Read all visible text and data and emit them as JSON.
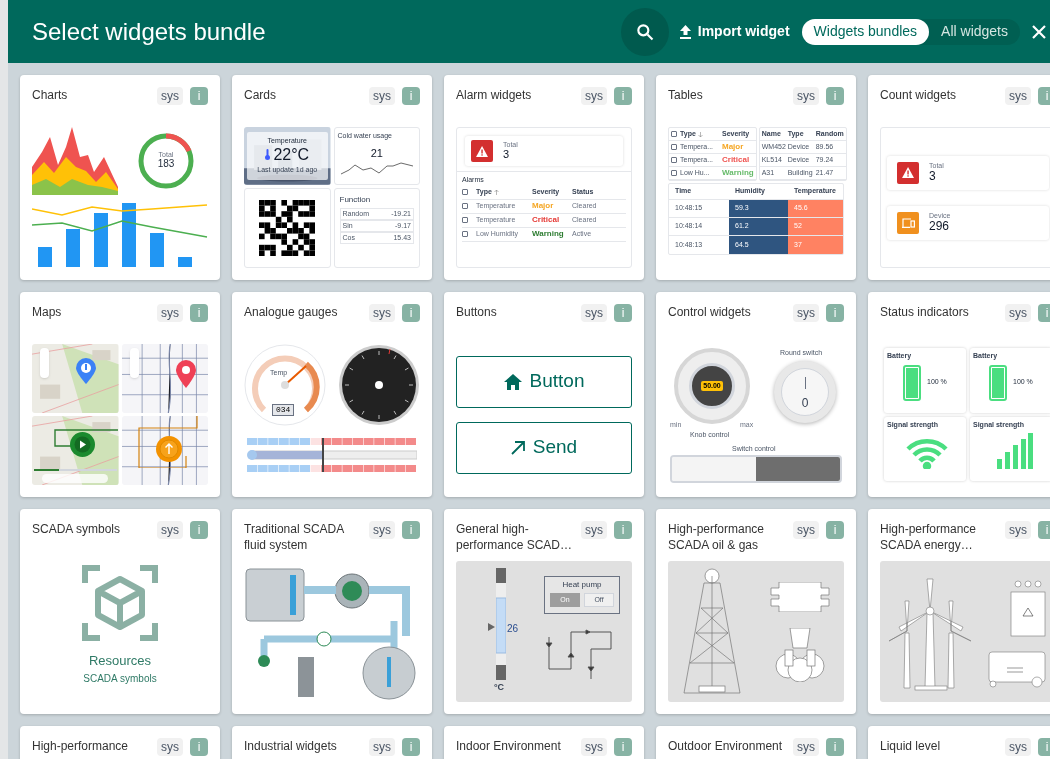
{
  "header": {
    "title": "Select widgets bundle",
    "import_label": "Import widget",
    "view_toggle": [
      {
        "label": "Widgets bundles",
        "selected": true
      },
      {
        "label": "All widgets",
        "selected": false
      }
    ]
  },
  "bundles": [
    {
      "title": "Charts",
      "badge": "sys",
      "info": "i",
      "preview": {
        "kind": "charts",
        "total_label": "Total",
        "total_value": "183"
      }
    },
    {
      "title": "Cards",
      "badge": "sys",
      "info": "i",
      "preview": {
        "kind": "cards",
        "temperature_label": "Temperature",
        "temperature_value": "22°C",
        "updated": "Last update 1d ago",
        "water_title": "Cold water usage",
        "water_value": "21",
        "function_title": "Function",
        "function_rows": [
          {
            "name": "Random",
            "value": "-19.21"
          },
          {
            "name": "Sin",
            "value": "-9.17"
          },
          {
            "name": "Cos",
            "value": "15.43"
          }
        ]
      }
    },
    {
      "title": "Alarm widgets",
      "badge": "sys",
      "info": "i",
      "preview": {
        "kind": "alarms",
        "total_label": "Total",
        "total_value": "3",
        "table_title": "Alarms",
        "all_checked": false,
        "columns": [
          "Type",
          "Severity",
          "Status"
        ],
        "rows": [
          {
            "checked": false,
            "type": "Temperature",
            "severity": "Major",
            "color": "#f5a623",
            "status": "Cleared"
          },
          {
            "checked": false,
            "type": "Temperature",
            "severity": "Critical",
            "color": "#e53935",
            "status": "Cleared"
          },
          {
            "checked": false,
            "type": "Low Humidity",
            "severity": "Warning",
            "color": "#2e7d32",
            "status": "Active"
          }
        ]
      }
    },
    {
      "title": "Tables",
      "badge": "sys",
      "info": "i",
      "preview": {
        "kind": "tables",
        "all_checked": false,
        "alarm_columns": [
          "Type",
          "Severity"
        ],
        "alarm_rows": [
          {
            "checked": false,
            "type": "Tempera...",
            "severity": "Major",
            "color": "#f5a623"
          },
          {
            "checked": false,
            "type": "Tempera...",
            "severity": "Critical",
            "color": "#ef5350"
          },
          {
            "checked": false,
            "type": "Low Hu...",
            "severity": "Warning",
            "color": "#66bb6a"
          }
        ],
        "entity_columns": [
          "Name",
          "Type",
          "Random"
        ],
        "entity_rows": [
          [
            "WM452",
            "Device",
            "89.56"
          ],
          [
            "KL514",
            "Device",
            "79.24"
          ],
          [
            "A31",
            "Building",
            "21.47"
          ]
        ],
        "series_columns": [
          "Time",
          "Humidity",
          "Temperature"
        ],
        "series_rows": [
          [
            "10:48:15",
            "59.3",
            "45.6"
          ],
          [
            "10:48:14",
            "61.2",
            "52"
          ],
          [
            "10:48:13",
            "64.5",
            "37"
          ]
        ]
      }
    },
    {
      "title": "Count widgets",
      "badge": "sys",
      "info": "i",
      "preview": {
        "kind": "counts",
        "items": [
          {
            "kind": "alarm",
            "label": "Total",
            "value": "3",
            "color": "#d32f2f"
          },
          {
            "kind": "device",
            "label": "Device",
            "value": "296",
            "color": "#f0901e"
          }
        ]
      }
    },
    {
      "title": "Maps",
      "badge": "sys",
      "info": "i",
      "preview": {
        "kind": "maps",
        "timeline": {
          "level": 0.3
        }
      }
    },
    {
      "title": "Analogue gauges",
      "badge": "sys",
      "info": "i",
      "preview": {
        "kind": "gauges",
        "gauge_label": "Temp",
        "gauge_value": "034"
      }
    },
    {
      "title": "Buttons",
      "badge": "sys",
      "info": "i",
      "preview": {
        "kind": "buttons",
        "items": [
          {
            "kind": "home",
            "label": "Button"
          },
          {
            "kind": "arrow",
            "label": "Send"
          }
        ]
      }
    },
    {
      "title": "Control widgets",
      "badge": "sys",
      "info": "i",
      "preview": {
        "kind": "controls",
        "knob_value": "50.00",
        "min": "min",
        "max": "max",
        "knob_label": "Knob control",
        "round_label": "Round switch",
        "round_value": "0",
        "round_on": false,
        "switch_label": "Switch control",
        "switch_on": false
      }
    },
    {
      "title": "Status indicators",
      "badge": "sys",
      "info": "i",
      "preview": {
        "kind": "status",
        "items": [
          {
            "kind": "battery",
            "label": "Battery",
            "reading": "100 %",
            "level": 1
          },
          {
            "kind": "battery",
            "label": "Battery",
            "reading": "100 %",
            "level": 1
          },
          {
            "kind": "wifi",
            "label": "Signal strength"
          },
          {
            "kind": "bars",
            "label": "Signal strength"
          }
        ]
      }
    },
    {
      "title": "SCADA symbols",
      "badge": "sys",
      "info": "i",
      "preview": {
        "kind": "symbols",
        "title": "Resources",
        "subtitle": "SCADA symbols"
      }
    },
    {
      "title": "Traditional SCADA fluid system",
      "badge": "sys",
      "info": "i",
      "preview": {
        "kind": "fluid"
      }
    },
    {
      "title": "General high-performance SCAD…",
      "badge": "sys",
      "info": "i",
      "preview": {
        "kind": "general",
        "panel_title": "Heat pump",
        "on_label": "On",
        "off_label": "Off",
        "value": "26",
        "unit": "°C"
      }
    },
    {
      "title": "High-performance SCADA oil & gas",
      "badge": "sys",
      "info": "i",
      "preview": {
        "kind": "oilgas"
      }
    },
    {
      "title": "High-performance SCADA energy…",
      "badge": "sys",
      "info": "i",
      "preview": {
        "kind": "energy"
      }
    },
    {
      "title": "High-performance",
      "badge": "sys",
      "info": "i"
    },
    {
      "title": "Industrial widgets",
      "badge": "sys",
      "info": "i"
    },
    {
      "title": "Indoor Environment",
      "badge": "sys",
      "info": "i"
    },
    {
      "title": "Outdoor Environment",
      "badge": "sys",
      "info": "i"
    },
    {
      "title": "Liquid level",
      "badge": "sys",
      "info": "i"
    }
  ]
}
